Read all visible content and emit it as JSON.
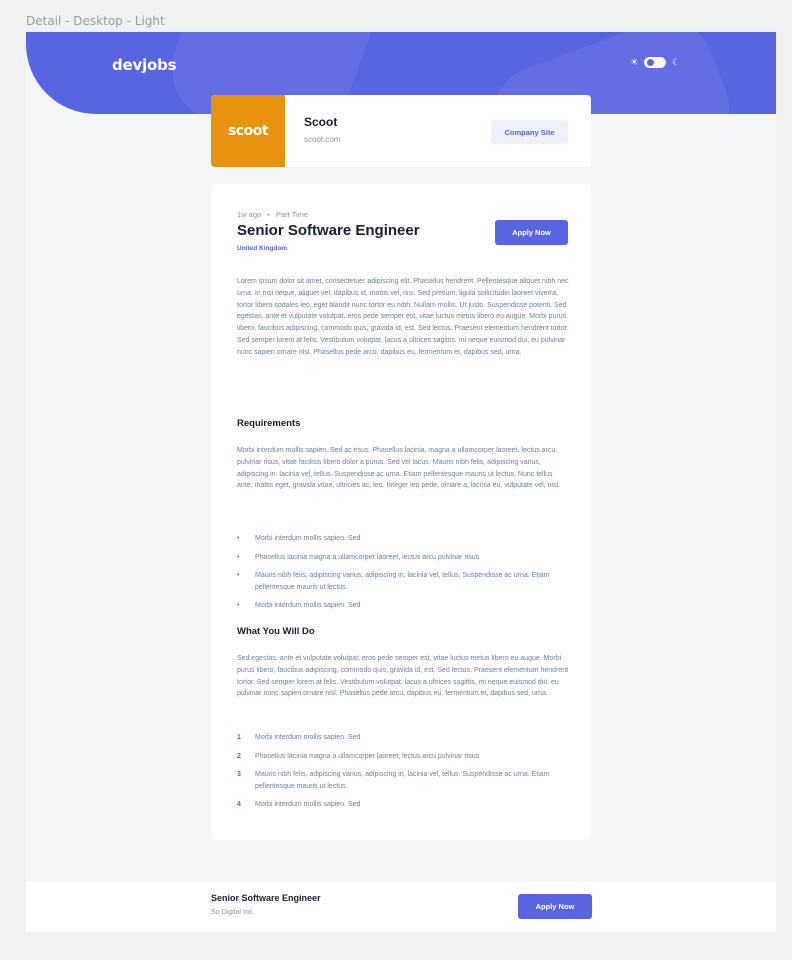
{
  "frame_label": "Detail - Desktop - Light",
  "colors": {
    "accent": "#5964e0",
    "company_logo_bg": "#e99210",
    "page_bg": "#f4f6f8"
  },
  "header": {
    "logo": "devjobs",
    "theme_toggle": {
      "sun_icon": "sun-icon",
      "moon_icon": "moon-icon",
      "state": "light"
    }
  },
  "company": {
    "logo_text": "scoot",
    "name": "Scoot",
    "url": "scoot.com",
    "site_button": "Company Site"
  },
  "job": {
    "posted": "1w ago",
    "separator": "•",
    "contract": "Part Time",
    "title": "Senior Software Engineer",
    "location": "United Kingdom",
    "apply_button": "Apply Now",
    "description": "Lorem ipsum dolor sit amet, consectetuer adipiscing elit. Phasellus hendrerit. Pellentesque aliquet nibh nec urna. In nisi neque, aliquet vel, dapibus id, mattis vel, nisi. Sed pretium, ligula sollicitudin laoreet viverra, tortor libero sodales leo, eget blandit nunc tortor eu nibh. Nullam mollis. Ut justo. Suspendisse potenti. Sed egestas, ante et vulputate volutpat, eros pede semper est, vitae luctus metus libero eu augue. Morbi purus libero, faucibus adipiscing, commodo quis, gravida id, est. Sed lectus. Praesent elementum hendrerit tortor. Sed semper lorem at felis. Vestibulum volutpat, lacus a ultrices sagittis, mi neque euismod dui, eu pulvinar nunc sapien ornare nisl. Phasellus pede arcu, dapibus eu, fermentum et, dapibus sed, urna.",
    "requirements": {
      "title": "Requirements",
      "text": "Morbi interdum mollis sapien. Sed ac risus. Phasellus lacinia, magna a ullamcorper laoreet, lectus arcu pulvinar risus, vitae facilisis libero dolor a purus. Sed vel lacus. Mauris nibh felis, adipiscing varius, adipiscing in, lacinia vel, tellus. Suspendisse ac urna. Etiam pellentesque mauris ut lectus. Nunc tellus ante, mattis eget, gravida vitae, ultricies ac, leo. Integer leo pede, ornare a, lacinia eu, vulputate vel, nisl.",
      "items": [
        "Morbi interdum mollis sapien. Sed",
        "Phasellus lacinia magna a ullamcorper laoreet, lectus arcu pulvinar risus",
        "Mauris nibh felis, adipiscing varius, adipiscing in, lacinia vel, tellus. Suspendisse ac urna. Etiam pellentesque mauris ut lectus.",
        "Morbi interdum mollis sapien. Sed"
      ]
    },
    "role": {
      "title": "What You Will Do",
      "text": "Sed egestas, ante et vulputate volutpat, eros pede semper est, vitae luctus metus libero eu augue. Morbi purus libero, faucibus adipiscing, commodo quis, gravida id, est. Sed lectus. Praesent elementum hendrerit tortor. Sed semper lorem at felis. Vestibulum volutpat, lacus a ultrices sagittis, mi neque euismod dui, eu pulvinar nunc sapien ornare nisl. Phasellus pede arcu, dapibus eu, fermentum et, dapibus sed, urna.",
      "items": [
        {
          "num": "1",
          "text": "Morbi interdum mollis sapien. Sed"
        },
        {
          "num": "2",
          "text": "Phasellus lacinia magna a ullamcorper laoreet, lectus arcu pulvinar risus"
        },
        {
          "num": "3",
          "text": "Mauris nibh felis, adipiscing varius, adipiscing in, lacinia vel, tellus. Suspendisse ac urna. Etiam pellentesque mauris ut lectus."
        },
        {
          "num": "4",
          "text": "Morbi interdum mollis sapien. Sed"
        }
      ]
    }
  },
  "footer": {
    "title": "Senior Software Engineer",
    "company": "So Digital Inc.",
    "apply_button": "Apply Now"
  }
}
